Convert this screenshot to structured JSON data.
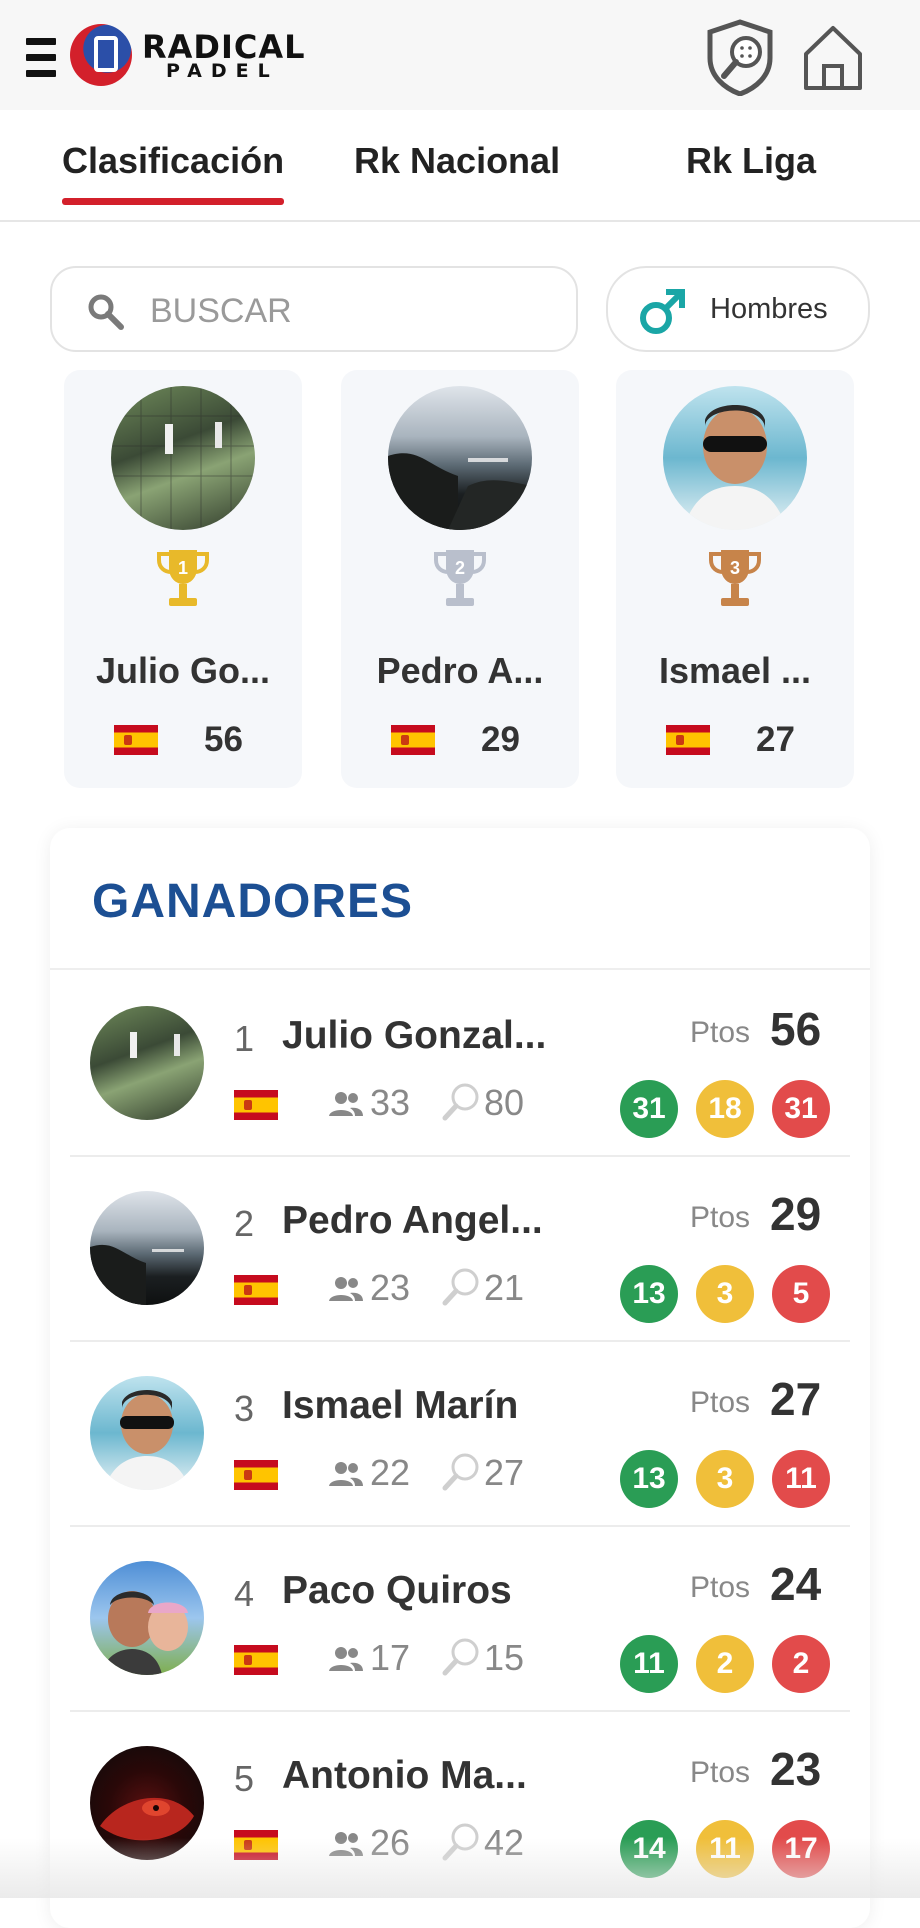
{
  "header": {
    "logo_line1": "RADICAL",
    "logo_line2": "PADEL",
    "icons": [
      "menu-icon",
      "shield-racket-icon",
      "home-icon"
    ]
  },
  "tabs": [
    {
      "label": "Clasificación",
      "active": true
    },
    {
      "label": "Rk Nacional",
      "active": false
    },
    {
      "label": "Rk Liga",
      "active": false
    }
  ],
  "search": {
    "placeholder": "BUSCAR"
  },
  "gender_filter": {
    "label": "Hombres",
    "icon": "male-icon"
  },
  "podium": [
    {
      "position": "1",
      "name": "Julio Go...",
      "points": "56",
      "trophy_color": "#e8b92a"
    },
    {
      "position": "2",
      "name": "Pedro A...",
      "points": "29",
      "trophy_color": "#b9bfcc"
    },
    {
      "position": "3",
      "name": "Ismael ...",
      "points": "27",
      "trophy_color": "#c7844a"
    }
  ],
  "winners": {
    "title": "GANADORES",
    "ptos_label": "Ptos",
    "rows": [
      {
        "rank": "1",
        "name": "Julio Gonzal...",
        "people": "33",
        "matches": "80",
        "points": "56",
        "green": "31",
        "yellow": "18",
        "red": "31"
      },
      {
        "rank": "2",
        "name": "Pedro Angel...",
        "people": "23",
        "matches": "21",
        "points": "29",
        "green": "13",
        "yellow": "3",
        "red": "5"
      },
      {
        "rank": "3",
        "name": "Ismael Marín",
        "people": "22",
        "matches": "27",
        "points": "27",
        "green": "13",
        "yellow": "3",
        "red": "11"
      },
      {
        "rank": "4",
        "name": "Paco Quiros",
        "people": "17",
        "matches": "15",
        "points": "24",
        "green": "11",
        "yellow": "2",
        "red": "2"
      },
      {
        "rank": "5",
        "name": "Antonio Ma...",
        "people": "26",
        "matches": "42",
        "points": "23",
        "green": "14",
        "yellow": "11",
        "red": "17"
      }
    ]
  },
  "colors": {
    "accent_red": "#d3202b",
    "title_blue": "#1c4f93",
    "green": "#2a9d55",
    "yellow": "#f0bf3a",
    "red": "#e24b4b",
    "male_teal": "#1aa6a6"
  }
}
